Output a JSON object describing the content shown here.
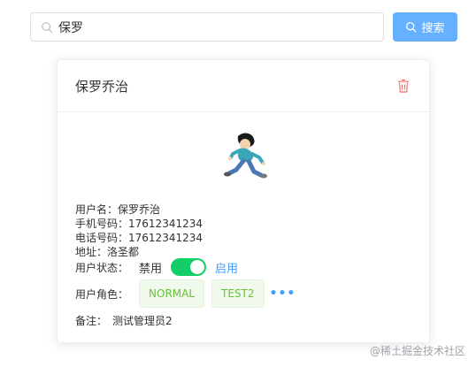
{
  "search": {
    "value": "保罗",
    "button_label": "搜索"
  },
  "card": {
    "title": "保罗乔治",
    "info": {
      "username_label": "用户名：",
      "username": "保罗乔治",
      "phone_label": "手机号码：",
      "phone": "17612341234",
      "tel_label": "电话号码：",
      "tel": "17612341234",
      "address_label": "地址：",
      "address": "洛圣都"
    },
    "status": {
      "label": "用户状态：",
      "off_text": "禁用",
      "on_text": "启用",
      "enabled": true
    },
    "roles": {
      "label": "用户角色：",
      "items": [
        "NORMAL",
        "TEST2"
      ],
      "more": "•••"
    },
    "note": {
      "label": "备注：",
      "value": "测试管理员2"
    }
  },
  "watermark": "@稀土掘金技术社区",
  "colors": {
    "primary": "#409eff",
    "success": "#13ce66",
    "danger": "#f56c6c"
  }
}
